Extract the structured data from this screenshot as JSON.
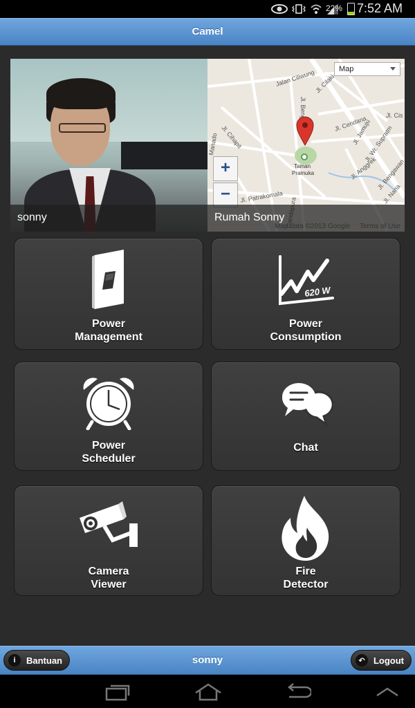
{
  "status_bar": {
    "battery_percent": "22%",
    "battery_level": 0.22,
    "time": "7:52 AM",
    "icons": [
      "eye-icon",
      "vibrate-icon",
      "wifi-icon",
      "signal-icon",
      "battery-icon"
    ]
  },
  "header": {
    "title": "Camel"
  },
  "profile": {
    "name": "sonny"
  },
  "map": {
    "type_selector": "Map",
    "zoom_in": "+",
    "zoom_out": "−",
    "location_caption": "Rumah Sonny",
    "attribution": "Map data ©2013 Google",
    "terms": "Terms of Use",
    "labels": {
      "road1": "Jalan Ciliwung",
      "road2": "Jl. Cilaki",
      "road3": "Jl. Cihapit",
      "road4": "Jl. Cendana",
      "road5": "Jl. Jamuju",
      "road6": "Jl. Wr. Supratm",
      "road7": "Jl. Anggrek",
      "road8": "Jl. Patrakomala",
      "road9": "Jl. Bengawan",
      "road10": "Jl. Nana",
      "road11": "Jl. Cis",
      "road12": "Jl. Beng",
      "road13": "Manado",
      "road14": "Gandapura",
      "park": "Taman Pramuka"
    }
  },
  "tiles": [
    {
      "line1": "Power",
      "line2": "Management",
      "icon": "switch-icon"
    },
    {
      "line1": "Power",
      "line2": "Consumption",
      "icon": "chart-icon",
      "icon_text": "620 W"
    },
    {
      "line1": "Power",
      "line2": "Scheduler",
      "icon": "alarm-clock-icon"
    },
    {
      "line1": "Chat",
      "line2": "",
      "icon": "chat-bubbles-icon"
    },
    {
      "line1": "Camera",
      "line2": "Viewer",
      "icon": "cctv-camera-icon"
    },
    {
      "line1": "Fire",
      "line2": "Detector",
      "icon": "flame-icon"
    }
  ],
  "footer": {
    "help_label": "Bantuan",
    "user": "sonny",
    "logout_label": "Logout"
  },
  "colors": {
    "header_blue": "#5b94d2",
    "background": "#2b2b2b",
    "tile": "#3a3a3a",
    "map_pin": "#d9362b",
    "park_green": "#b9d7a6"
  }
}
